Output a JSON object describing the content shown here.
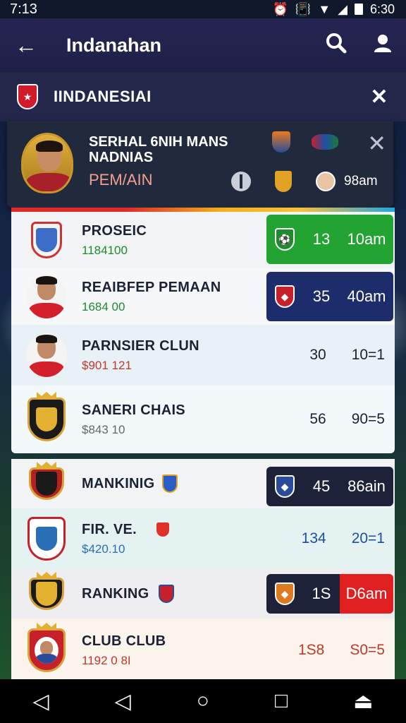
{
  "status_bar": {
    "time": "7:13",
    "clock": "6:30"
  },
  "app_bar": {
    "title": "Indanahan"
  },
  "club_bar": {
    "name": "IINDANESIAI"
  },
  "profile": {
    "name": "SERHAL 6NIH MANS\nNADNIAS",
    "role": "PEM/AIN",
    "stat": "98am"
  },
  "rows": [
    {
      "primary": "PROSEIC",
      "secondary": "1184100",
      "secondary_color": "#1f8a2e",
      "stat_a": "13",
      "stat_b": "10am",
      "pill_color": "#22a332",
      "bg": "#f1f3f5"
    },
    {
      "primary": "REAIBFEP PEMAAN",
      "secondary": "1684 00",
      "secondary_color": "#1f8a2e",
      "stat_a": "35",
      "stat_b": "40am",
      "pill_color": "#1d2c6a",
      "bg": "#f6f7f9"
    },
    {
      "primary": "PARNSIER CLUN",
      "secondary": "$901 121",
      "secondary_color": "#c0392b",
      "stat_a": "30",
      "stat_b": "10=1",
      "bg": "#e8f1f6"
    },
    {
      "primary": "SANERI CHAIS",
      "secondary": "$843 10",
      "secondary_color": "#666666",
      "stat_a": "56",
      "stat_b": "90=5",
      "bg": "#f3f8fb"
    },
    {
      "primary": "MANKINIG",
      "secondary": "",
      "stat_a": "45",
      "stat_b": "86ain",
      "pill_color": "#1d2238",
      "bg": "#f1f3f5"
    },
    {
      "primary": "FIR. VE.",
      "secondary": "$420.10",
      "secondary_color": "#2a6fb5",
      "stat_a": "134",
      "stat_b": "20=1",
      "stats_color": "#1d4e9b",
      "bg": "#e4f3f2"
    },
    {
      "primary": "RANKING",
      "secondary": "",
      "stat_a": "1S",
      "stat_b": "D6am",
      "pill_color": "#1d2238",
      "bg": "#eeeef1"
    },
    {
      "primary": "CLUB CLUB",
      "secondary": "1192 0 8I",
      "secondary_color": "#c0392b",
      "stat_a": "1S8",
      "stat_b": "S0=5",
      "stats_color": "#c0392b",
      "bg": "#fbf4ec"
    }
  ]
}
